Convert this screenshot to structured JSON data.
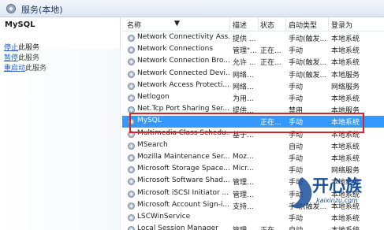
{
  "window": {
    "title": "服务(本地)"
  },
  "left_pane": {
    "service_name": "MySQL",
    "actions": [
      {
        "link": "停止",
        "rest": "此服务"
      },
      {
        "link": "暂停",
        "rest": "此服务"
      },
      {
        "link": "重启动",
        "rest": "此服务"
      }
    ]
  },
  "columns": {
    "name": "名称",
    "desc": "描述",
    "status": "状态",
    "startup": "启动类型",
    "logon": "登录为"
  },
  "rows": [
    {
      "name": "Network Connectivity Ass...",
      "desc": "提供 ...",
      "status": "",
      "startup": "手动(触发...",
      "logon": "本地系统"
    },
    {
      "name": "Network Connections",
      "desc": "管理\"...",
      "status": "正在...",
      "startup": "手动",
      "logon": "本地系统"
    },
    {
      "name": "Network Connection Bro...",
      "desc": "允许 ...",
      "status": "正在...",
      "startup": "手动(触发...",
      "logon": "本地系统"
    },
    {
      "name": "Network Connected Devi...",
      "desc": "网络...",
      "status": "",
      "startup": "手动(触发...",
      "logon": "本地服务"
    },
    {
      "name": "Network Access Protecti...",
      "desc": "网络...",
      "status": "",
      "startup": "手动",
      "logon": "网络服务"
    },
    {
      "name": "Netlogon",
      "desc": "为用...",
      "status": "",
      "startup": "手动",
      "logon": "本地系统"
    },
    {
      "name": "Net.Tcp Port Sharing Ser...",
      "desc": "提供...",
      "status": "",
      "startup": "禁用",
      "logon": "本地服务"
    },
    {
      "name": "MySQL",
      "desc": "",
      "status": "正在...",
      "startup": "手动",
      "logon": "本地系统",
      "selected": true
    },
    {
      "name": "Multimedia Class Schedu...",
      "desc": "基于...",
      "status": "",
      "startup": "手动",
      "logon": "本地系统"
    },
    {
      "name": "MSearch",
      "desc": "",
      "status": "",
      "startup": "自动",
      "logon": "本地系统"
    },
    {
      "name": "Mozilla Maintenance Ser...",
      "desc": "Moz...",
      "status": "",
      "startup": "手动",
      "logon": "本地系统"
    },
    {
      "name": "Microsoft Storage Space...",
      "desc": "Micr...",
      "status": "",
      "startup": "手动",
      "logon": "网络服务"
    },
    {
      "name": "Microsoft Software Shad...",
      "desc": "管理...",
      "status": "",
      "startup": "手动",
      "logon": "本地系统"
    },
    {
      "name": "Microsoft iSCSI Initiator ...",
      "desc": "管理...",
      "status": "",
      "startup": "手动",
      "logon": "本地系统"
    },
    {
      "name": "Microsoft Account Sign-i...",
      "desc": "支持...",
      "status": "",
      "startup": "手动(触发...",
      "logon": "本地系统"
    },
    {
      "name": "LSCWinService",
      "desc": "",
      "status": "",
      "startup": "手动",
      "logon": "本地系统"
    },
    {
      "name": "Local Session Manager",
      "desc": "管理...",
      "status": "正在...",
      "startup": "自动",
      "logon": "本地系统"
    }
  ],
  "icons": {
    "window": "gear-icon",
    "service": "service-gear-icon"
  },
  "colors": {
    "selection": "#3399ff",
    "highlight_border": "#d8232a",
    "link": "#1a55c4"
  },
  "watermark": {
    "text": "开心族",
    "url": "kaixinzu.com"
  }
}
